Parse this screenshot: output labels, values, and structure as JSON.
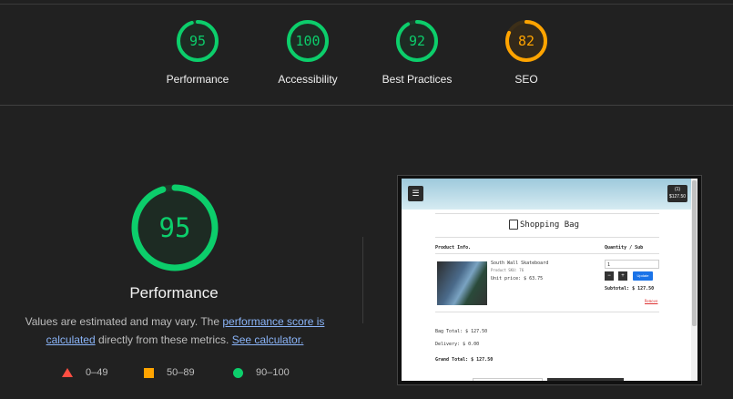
{
  "summary": [
    {
      "score": "95",
      "label": "Performance",
      "value": 95,
      "color": "#0cce6b"
    },
    {
      "score": "100",
      "label": "Accessibility",
      "value": 100,
      "color": "#0cce6b"
    },
    {
      "score": "92",
      "label": "Best Practices",
      "value": 92,
      "color": "#0cce6b"
    },
    {
      "score": "82",
      "label": "SEO",
      "value": 82,
      "color": "#ffa400"
    }
  ],
  "main": {
    "score": "95",
    "value": 95,
    "title": "Performance",
    "desc_pre": "Values are estimated and may vary. The ",
    "desc_link1": "performance score is calculated",
    "desc_mid": " directly from these metrics. ",
    "desc_link2": "See calculator."
  },
  "legend": [
    {
      "shape": "triangle",
      "range": "0–49",
      "color": "#ff4e42"
    },
    {
      "shape": "square",
      "range": "50–89",
      "color": "#ffa400"
    },
    {
      "shape": "circle",
      "range": "90–100",
      "color": "#0cce6b"
    }
  ],
  "screenshot": {
    "menu_icon": "hamburger-icon",
    "cart_icon": "cart-icon",
    "cart_count": "(1)",
    "cart_total": "$127.50",
    "title": "Shopping Bag",
    "bag_icon": "shopping-bag-icon",
    "col_product": "Product Info.",
    "col_qty": "Quantity / Sub",
    "product_name": "South Wall Skateboard",
    "product_code": "Product SKU: 76",
    "unit_price": "Unit price: $ 63.75",
    "qty_value": "1",
    "minus": "−",
    "plus": "+",
    "update": "Update",
    "subtotal": "Subtotal: $ 127.50",
    "remove": "Remove",
    "bag_total": "Bag Total: $ 127.50",
    "delivery": "Delivery: $ 0.00",
    "grand_total": "Grand Total: $ 127.50"
  }
}
